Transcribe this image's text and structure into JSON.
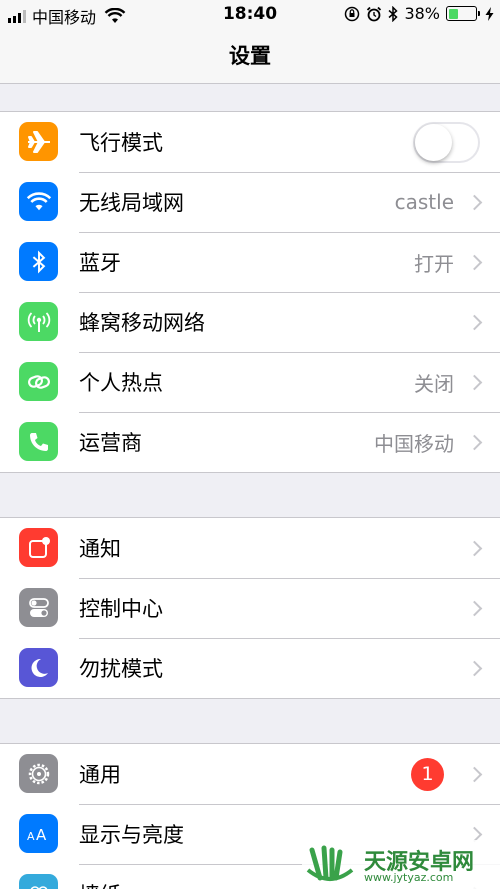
{
  "status_bar": {
    "carrier": "中国移动",
    "time": "18:40",
    "battery_percent": "38%",
    "battery_level": 0.38
  },
  "nav": {
    "title": "设置"
  },
  "group1": [
    {
      "label": "飞行模式",
      "icon": "airplane-icon",
      "color": "#ff9500",
      "toggle": false
    },
    {
      "label": "无线局域网",
      "icon": "wifi-icon",
      "color": "#007aff",
      "value": "castle"
    },
    {
      "label": "蓝牙",
      "icon": "bluetooth-icon",
      "color": "#007aff",
      "value": "打开"
    },
    {
      "label": "蜂窝移动网络",
      "icon": "cellular-icon",
      "color": "#4cd964",
      "value": ""
    },
    {
      "label": "个人热点",
      "icon": "hotspot-icon",
      "color": "#4cd964",
      "value": "关闭"
    },
    {
      "label": "运营商",
      "icon": "phone-icon",
      "color": "#4cd964",
      "value": "中国移动"
    }
  ],
  "group2": [
    {
      "label": "通知",
      "icon": "notifications-icon",
      "color": "#ff3b30"
    },
    {
      "label": "控制中心",
      "icon": "control-center-icon",
      "color": "#8e8e93"
    },
    {
      "label": "勿扰模式",
      "icon": "moon-icon",
      "color": "#5856d6"
    }
  ],
  "group3": [
    {
      "label": "通用",
      "icon": "gear-icon",
      "color": "#8e8e93",
      "badge": "1"
    },
    {
      "label": "显示与亮度",
      "icon": "display-icon",
      "color": "#007aff"
    },
    {
      "label": "墙纸",
      "icon": "wallpaper-icon",
      "color": "#34aadc"
    }
  ],
  "watermark": {
    "brand": "天源安卓网",
    "url": "www.jytyaz.com"
  }
}
